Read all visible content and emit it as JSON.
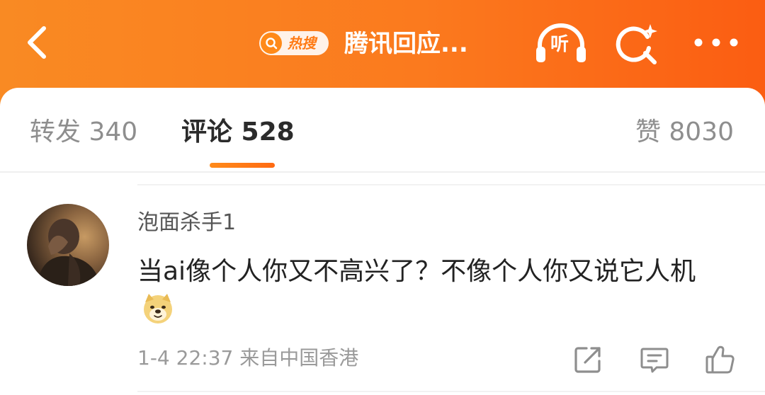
{
  "header": {
    "hot_badge_text": "热搜",
    "title": "腾讯回应...",
    "listen_label": "听",
    "background_color": "#fb7a1e",
    "icons": [
      "back-arrow-icon",
      "search-q-icon",
      "headphones-icon",
      "search-sparkle-icon",
      "more-dots-icon"
    ]
  },
  "tabs": [
    {
      "label": "转发 340",
      "active": false
    },
    {
      "label": "评论 528",
      "active": true
    },
    {
      "label": "赞 8030",
      "active": false
    }
  ],
  "comment": {
    "username": "泡面杀手1",
    "text": "当ai像个人你又不高兴了？不像个人你又说它人机",
    "emoji": "doge-emoji",
    "meta": "1-4 22:37  来自中国香港",
    "action_icons": [
      "repost-icon",
      "comment-icon",
      "like-icon"
    ]
  },
  "colors": {
    "accent": "#ff7a14",
    "active_tab_text": "#2b2b2b",
    "inactive_tab_text": "#8e8e8e"
  }
}
